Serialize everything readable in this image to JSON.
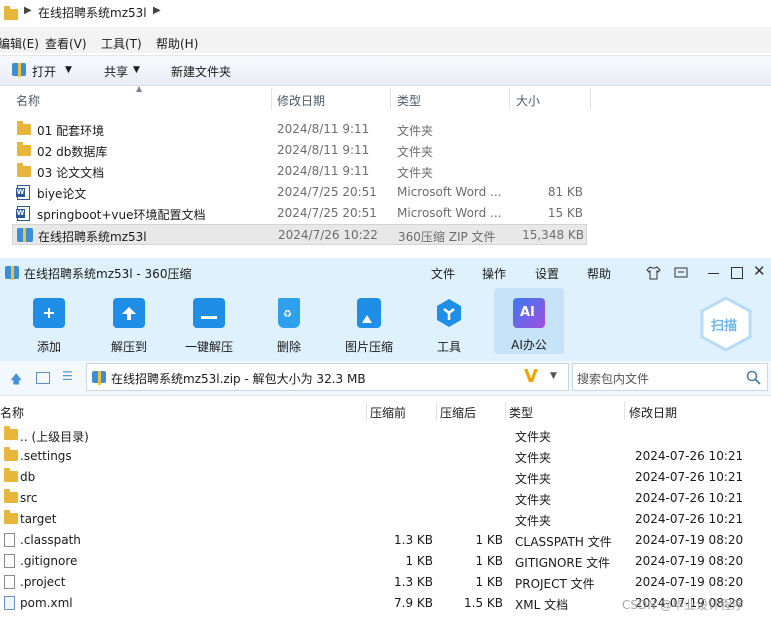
{
  "explorer": {
    "breadcrumb": "在线招聘系统mz53l",
    "menu": [
      "编辑(E)",
      "查看(V)",
      "工具(T)",
      "帮助(H)"
    ],
    "toolbar": {
      "open": "打开",
      "share": "共享",
      "new_folder": "新建文件夹"
    },
    "columns": {
      "name": "名称",
      "date": "修改日期",
      "type": "类型",
      "size": "大小"
    },
    "rows": [
      {
        "name": "01 配套环境",
        "date": "2024/8/11 9:11",
        "type": "文件夹",
        "size": "",
        "icon": "folder-icon"
      },
      {
        "name": "02 db数据库",
        "date": "2024/8/11 9:11",
        "type": "文件夹",
        "size": "",
        "icon": "folder-icon"
      },
      {
        "name": "03 论文文档",
        "date": "2024/8/11 9:11",
        "type": "文件夹",
        "size": "",
        "icon": "folder-icon"
      },
      {
        "name": "biye论文",
        "date": "2024/7/25 20:51",
        "type": "Microsoft Word ...",
        "size": "81 KB",
        "icon": "word-doc-icon"
      },
      {
        "name": "springboot+vue环境配置文档",
        "date": "2024/7/25 20:51",
        "type": "Microsoft Word ...",
        "size": "15 KB",
        "icon": "word-doc-icon"
      },
      {
        "name": "在线招聘系统mz53l",
        "date": "2024/7/26 10:22",
        "type": "360压缩 ZIP 文件",
        "size": "15,348 KB",
        "icon": "zip-icon"
      }
    ]
  },
  "zip": {
    "title": "在线招聘系统mz53l - 360压缩",
    "menu": [
      "文件",
      "操作",
      "设置",
      "帮助"
    ],
    "tools": [
      "添加",
      "解压到",
      "一键解压",
      "删除",
      "图片压缩",
      "工具",
      "AI办公"
    ],
    "scan": "扫描",
    "ai_badge": "AI",
    "path": "在线招聘系统mz53l.zip - 解包大小为 32.3 MB",
    "search_placeholder": "搜索包内文件",
    "columns": {
      "name": "名称",
      "before": "压缩前",
      "after": "压缩后",
      "type": "类型",
      "date": "修改日期"
    },
    "rows": [
      {
        "name": ".. (上级目录)",
        "before": "",
        "after": "",
        "type": "文件夹",
        "date": "",
        "icon": "folder-icon"
      },
      {
        "name": ".settings",
        "before": "",
        "after": "",
        "type": "文件夹",
        "date": "2024-07-26 10:21",
        "icon": "folder-icon"
      },
      {
        "name": "db",
        "before": "",
        "after": "",
        "type": "文件夹",
        "date": "2024-07-26 10:21",
        "icon": "folder-icon"
      },
      {
        "name": "src",
        "before": "",
        "after": "",
        "type": "文件夹",
        "date": "2024-07-26 10:21",
        "icon": "folder-icon"
      },
      {
        "name": "target",
        "before": "",
        "after": "",
        "type": "文件夹",
        "date": "2024-07-26 10:21",
        "icon": "folder-icon"
      },
      {
        "name": ".classpath",
        "before": "1.3 KB",
        "after": "1 KB",
        "type": "CLASSPATH 文件",
        "date": "2024-07-19 08:20",
        "icon": "file-icon"
      },
      {
        "name": ".gitignore",
        "before": "1 KB",
        "after": "1 KB",
        "type": "GITIGNORE 文件",
        "date": "2024-07-19 08:20",
        "icon": "file-icon"
      },
      {
        "name": ".project",
        "before": "1.3 KB",
        "after": "1 KB",
        "type": "PROJECT 文件",
        "date": "2024-07-19 08:20",
        "icon": "file-icon"
      },
      {
        "name": "pom.xml",
        "before": "7.9 KB",
        "after": "1.5 KB",
        "type": "XML 文档",
        "date": "2024-07-19 08:20",
        "icon": "xml-file-icon"
      }
    ],
    "watermark": "CSDN @毕业设计程序"
  }
}
